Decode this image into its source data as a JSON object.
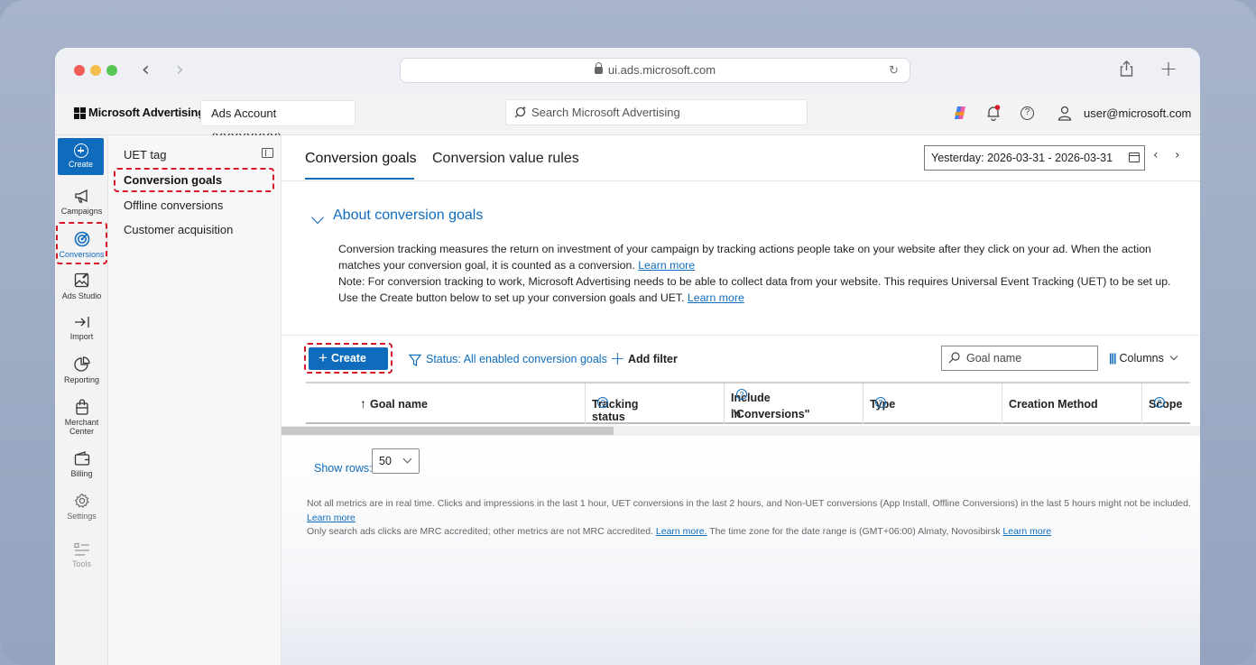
{
  "browser": {
    "url": "ui.ads.microsoft.com",
    "back_glyph": "‹",
    "forward_glyph": "›",
    "reload_glyph": "↻",
    "new_tab_glyph": "+"
  },
  "appbar": {
    "brand": "Microsoft Advertising",
    "account_label": "Ads Account (XXXXXXXX)",
    "account_chevron": "⌄",
    "search_placeholder": "Search Microsoft Advertising",
    "user_email": "user@microsoft.com"
  },
  "rail": {
    "items": [
      {
        "label": "Create",
        "icon": "plus-circle-icon"
      },
      {
        "label": "Campaigns",
        "icon": "megaphone-icon"
      },
      {
        "label": "Conversions",
        "icon": "target-icon"
      },
      {
        "label": "Ads Studio",
        "icon": "image-edit-icon"
      },
      {
        "label": "Import",
        "icon": "import-arrow-icon"
      },
      {
        "label": "Reporting",
        "icon": "pie-chart-icon"
      },
      {
        "label": "Merchant Center",
        "icon": "shopping-bag-icon"
      },
      {
        "label": "Billing",
        "icon": "wallet-icon"
      },
      {
        "label": "Settings",
        "icon": "gear-icon"
      },
      {
        "label": "Tools",
        "icon": "tools-list-icon"
      }
    ],
    "merchant_line1": "Merchant",
    "merchant_line2": "Center"
  },
  "subnav": {
    "items": [
      {
        "label": "UET tag"
      },
      {
        "label": "Conversion goals",
        "selected": true
      },
      {
        "label": "Offline conversions"
      },
      {
        "label": "Customer acquisition"
      }
    ]
  },
  "main": {
    "tabs": [
      {
        "label": "Conversion goals",
        "active": true
      },
      {
        "label": "Conversion value rules"
      }
    ],
    "date_range": "Yesterday: 2026-03-31 - 2026-03-31",
    "date_prev": "‹",
    "date_next": "›",
    "about_title": "About conversion goals",
    "about_p1": "Conversion tracking measures the return on investment of your campaign by tracking actions people take on your website after they click on your ad. When the action matches your conversion goal, it is counted as a conversion.",
    "about_p2": "Note: For conversion tracking to work, Microsoft Advertising needs to be able to collect data from your website. This requires Universal Event Tracking (UET) to be set up. Use the Create button below to set up your conversion goals and UET.",
    "learn_more": "Learn more",
    "toolbar": {
      "create_label": "Create",
      "create_plus": "+",
      "status_filter": "Status: All enabled conversion goals",
      "add_filter_plus": "+",
      "add_filter": "Add filter",
      "goal_search_placeholder": "Goal name",
      "columns_bars": "|||",
      "columns_label": "Columns"
    },
    "table": {
      "sort_arrow": "↑",
      "help_glyph": "?",
      "columns": [
        {
          "label": "Goal name"
        },
        {
          "label": "Tracking status"
        },
        {
          "label_line1": "Include in",
          "label_line2": "\"Conversions\""
        },
        {
          "label": "Type"
        },
        {
          "label": "Creation Method"
        },
        {
          "label": "Scope"
        }
      ]
    },
    "show_rows_label": "Show rows:",
    "show_rows_value": "50",
    "notes": {
      "line1": "Not all metrics are in real time. Clicks and impressions in the last 1 hour, UET conversions in the last 2 hours, and Non-UET conversions (App Install, Offline Conversions) in the last 5 hours might not be included.",
      "line1_link": "Learn more",
      "line2_a": "Only search ads clicks are MRC accredited; other metrics are not MRC accredited.",
      "line2_link1": "Learn more.",
      "line2_b": "The time zone for the date range is (GMT+06:00) Almaty, Novosibirsk",
      "line2_link2": "Learn more"
    }
  },
  "colors": {
    "accent": "#0f6cbd",
    "highlight_dashed": "#d7182a"
  }
}
